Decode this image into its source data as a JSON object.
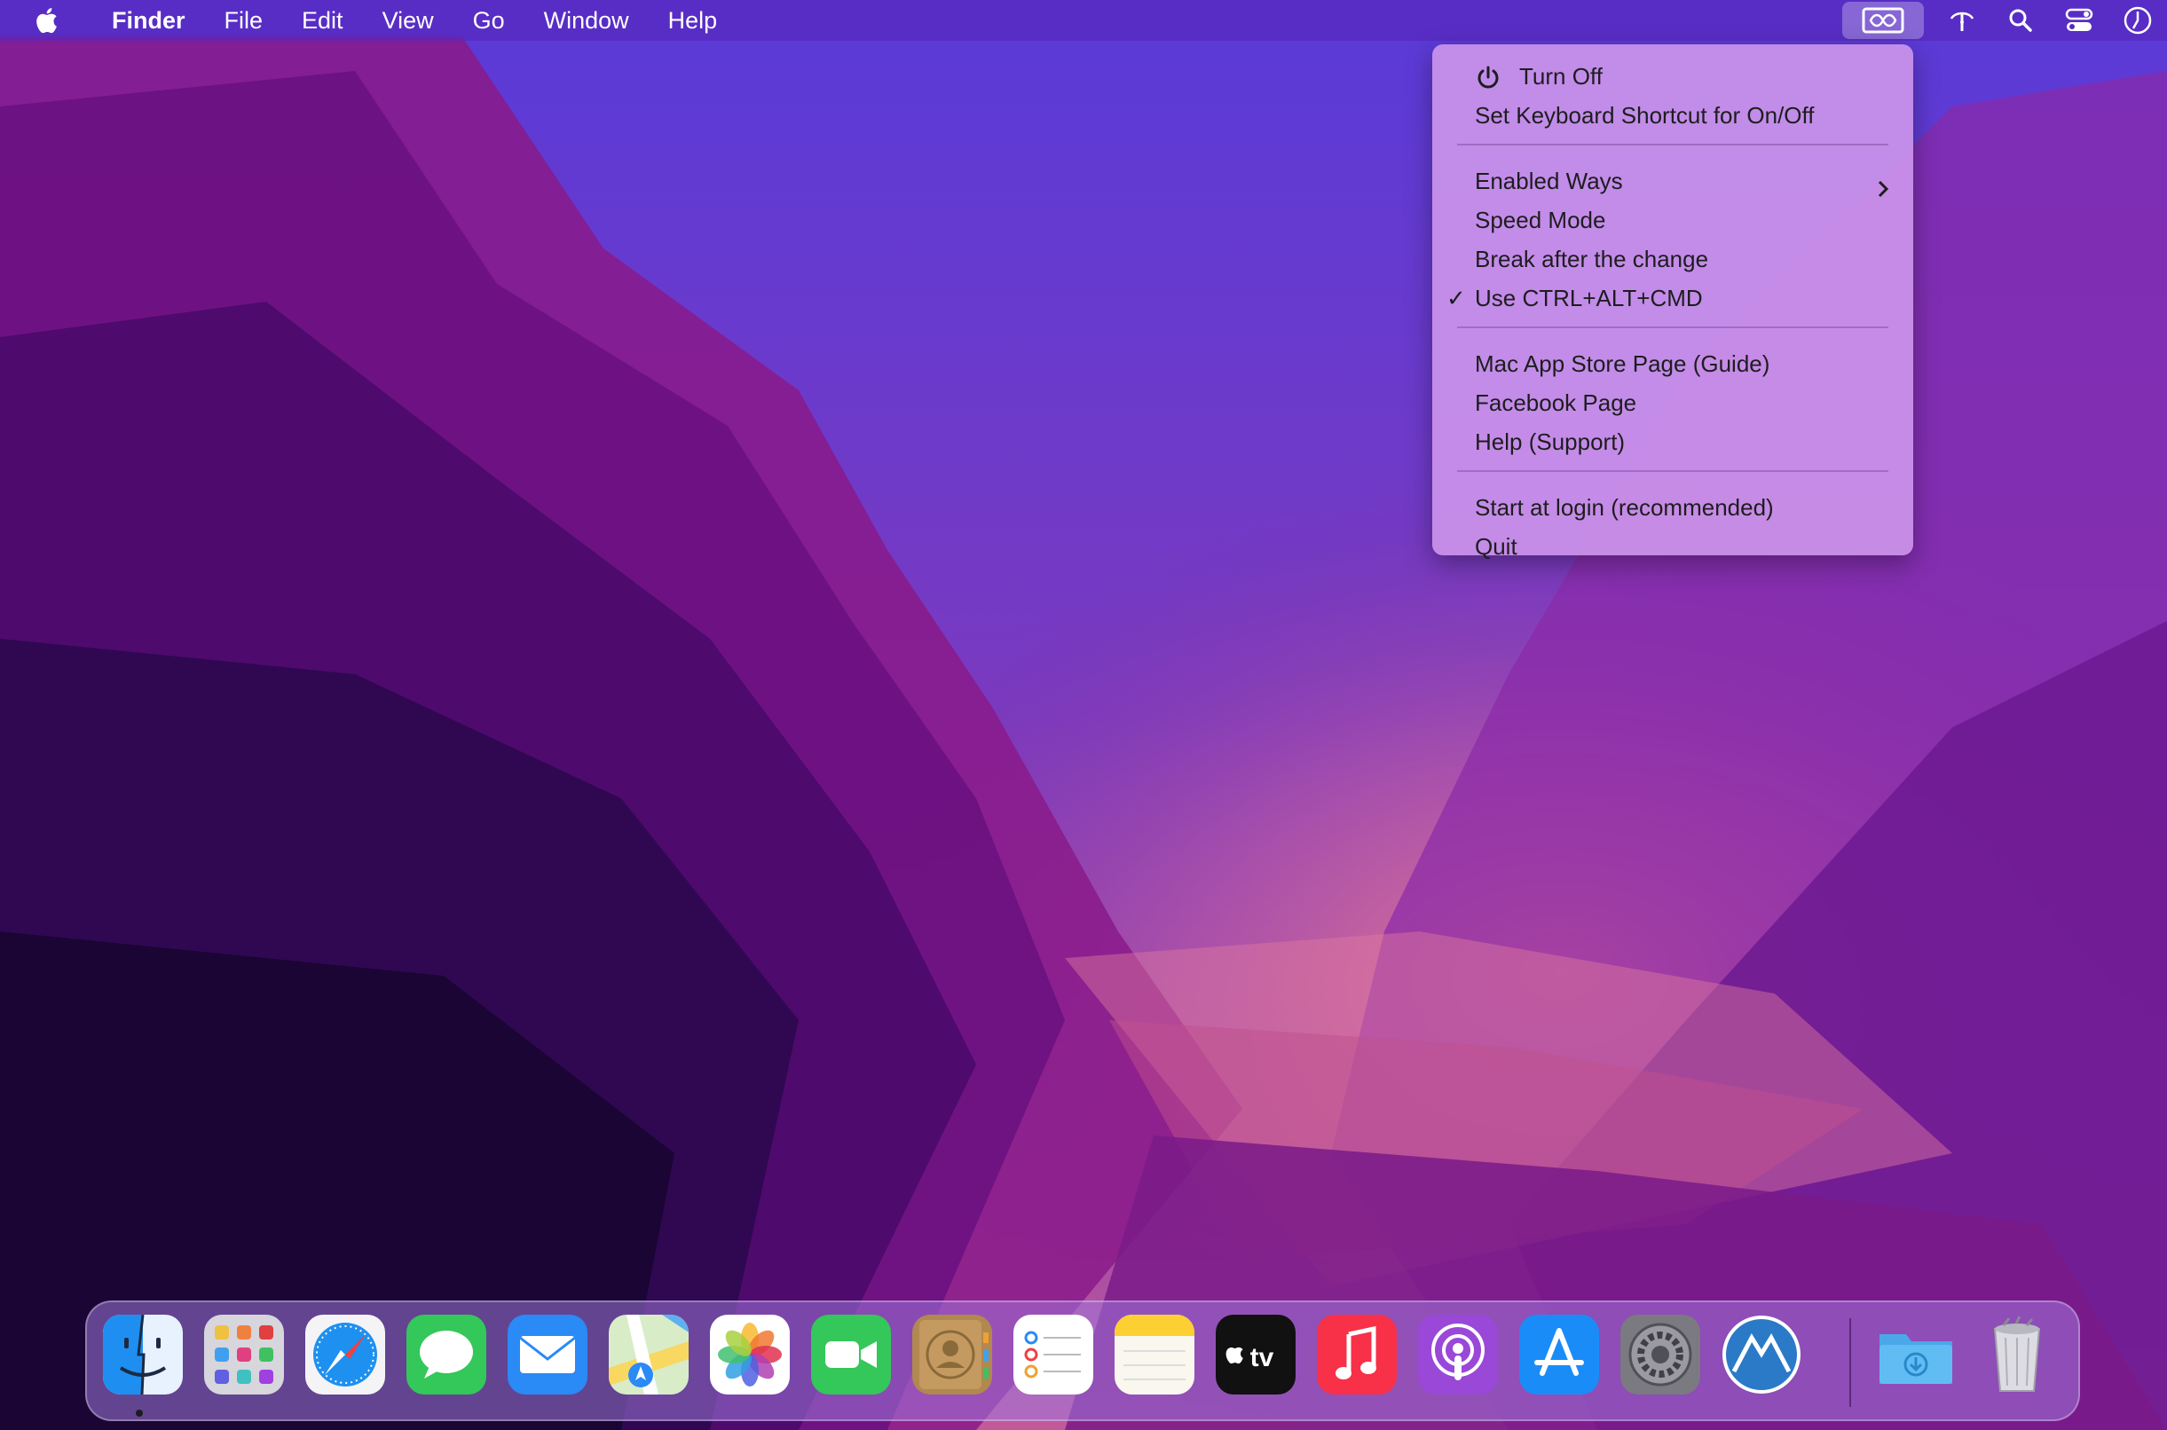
{
  "menubar": {
    "apple_icon": "apple-logo-icon",
    "app_name": "Finder",
    "items": [
      "File",
      "Edit",
      "View",
      "Go",
      "Window",
      "Help"
    ],
    "status_icons": [
      "pointer-app-icon",
      "antenna-icon",
      "search-icon",
      "control-center-icon",
      "clock-icon"
    ]
  },
  "dropdown": {
    "turn_off": "Turn Off",
    "shortcut": "Set Keyboard Shortcut for On/Off",
    "enabled_ways": "Enabled Ways",
    "speed_mode": "Speed Mode",
    "break_after": "Break after the change",
    "use_ctrl": "Use CTRL+ALT+CMD",
    "check_mark": "✓",
    "app_store": "Mac App Store Page (Guide)",
    "facebook": "Facebook Page",
    "help": "Help (Support)",
    "start_login": "Start at login (recommended)",
    "quit": "Quit"
  },
  "dock": {
    "apps": [
      "Finder",
      "Launchpad",
      "Safari",
      "Messages",
      "Mail",
      "Maps",
      "Photos",
      "FaceTime",
      "Contacts",
      "Reminders",
      "Notes",
      "TV",
      "Music",
      "Podcasts",
      "App Store",
      "System Preferences",
      "Pointer App",
      "Downloads",
      "Trash"
    ],
    "tv_label": "tv"
  },
  "colors": {
    "menubar": "#5828be",
    "menu_bg": "#cd96eb",
    "accent": "#6b3fd0"
  }
}
